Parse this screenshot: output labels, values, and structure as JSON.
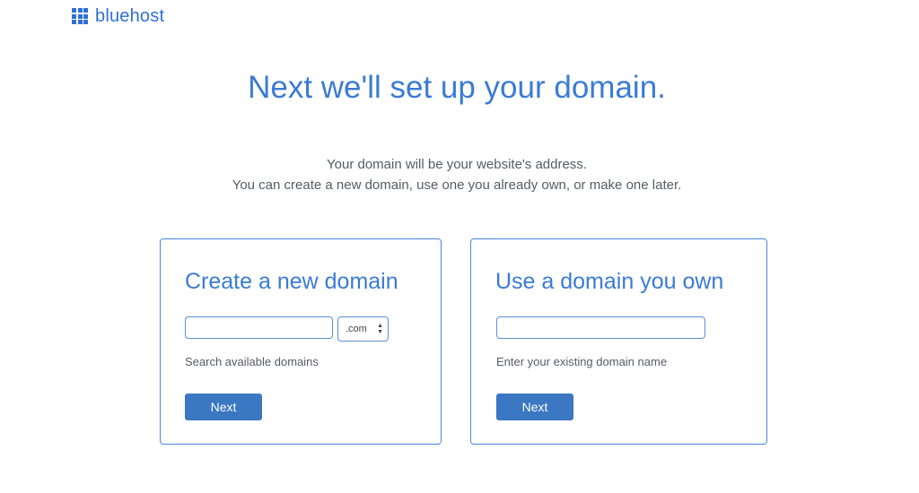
{
  "header": {
    "logo_text": "bluehost",
    "logo_icon": "grid-icon",
    "brand_color": "#2f6fd8"
  },
  "main": {
    "headline": "Next we'll set up your domain.",
    "subtext_line1": "Your domain will be your website's address.",
    "subtext_line2": "You can create a new domain, use one you already own, or make one later."
  },
  "new_domain": {
    "title": "Create a new domain",
    "input_value": "",
    "input_placeholder": "",
    "tld_selected": ".com",
    "helper": "Search available domains",
    "next_label": "Next"
  },
  "own_domain": {
    "title": "Use a domain you own",
    "input_value": "",
    "input_placeholder": "",
    "helper": "Enter your existing domain name",
    "next_label": "Next"
  },
  "colors": {
    "accent": "#3a7bd5",
    "button": "#3b77c2",
    "border": "#4a86e0"
  }
}
